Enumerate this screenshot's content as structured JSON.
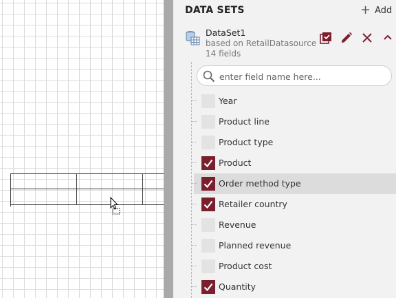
{
  "panel": {
    "title": "DATA SETS",
    "add_label": "Add"
  },
  "dataset": {
    "name": "DataSet1",
    "source": "based on RetailDatasource",
    "field_count": "14 fields"
  },
  "search": {
    "placeholder": "enter field name here..."
  },
  "fields": [
    {
      "label": "Year",
      "checked": false,
      "selected": false
    },
    {
      "label": "Product line",
      "checked": false,
      "selected": false
    },
    {
      "label": "Product type",
      "checked": false,
      "selected": false
    },
    {
      "label": "Product",
      "checked": true,
      "selected": false
    },
    {
      "label": "Order method type",
      "checked": true,
      "selected": true
    },
    {
      "label": "Retailer country",
      "checked": true,
      "selected": false
    },
    {
      "label": "Revenue",
      "checked": false,
      "selected": false
    },
    {
      "label": "Planned revenue",
      "checked": false,
      "selected": false
    },
    {
      "label": "Product cost",
      "checked": false,
      "selected": false
    },
    {
      "label": "Quantity",
      "checked": true,
      "selected": false
    }
  ],
  "colors": {
    "accent": "#7a1f2e",
    "panel_bg": "#f2f2f2",
    "splitter": "#a9a9a9",
    "selected_row": "#dcdcdc"
  },
  "icons": {
    "dataset": "database-table-icon",
    "add": "plus-icon",
    "select_all": "select-all-icon",
    "edit": "pencil-icon",
    "remove": "close-icon",
    "collapse": "chevron-up-icon",
    "search": "search-icon",
    "cursor": "drag-cursor-icon"
  }
}
